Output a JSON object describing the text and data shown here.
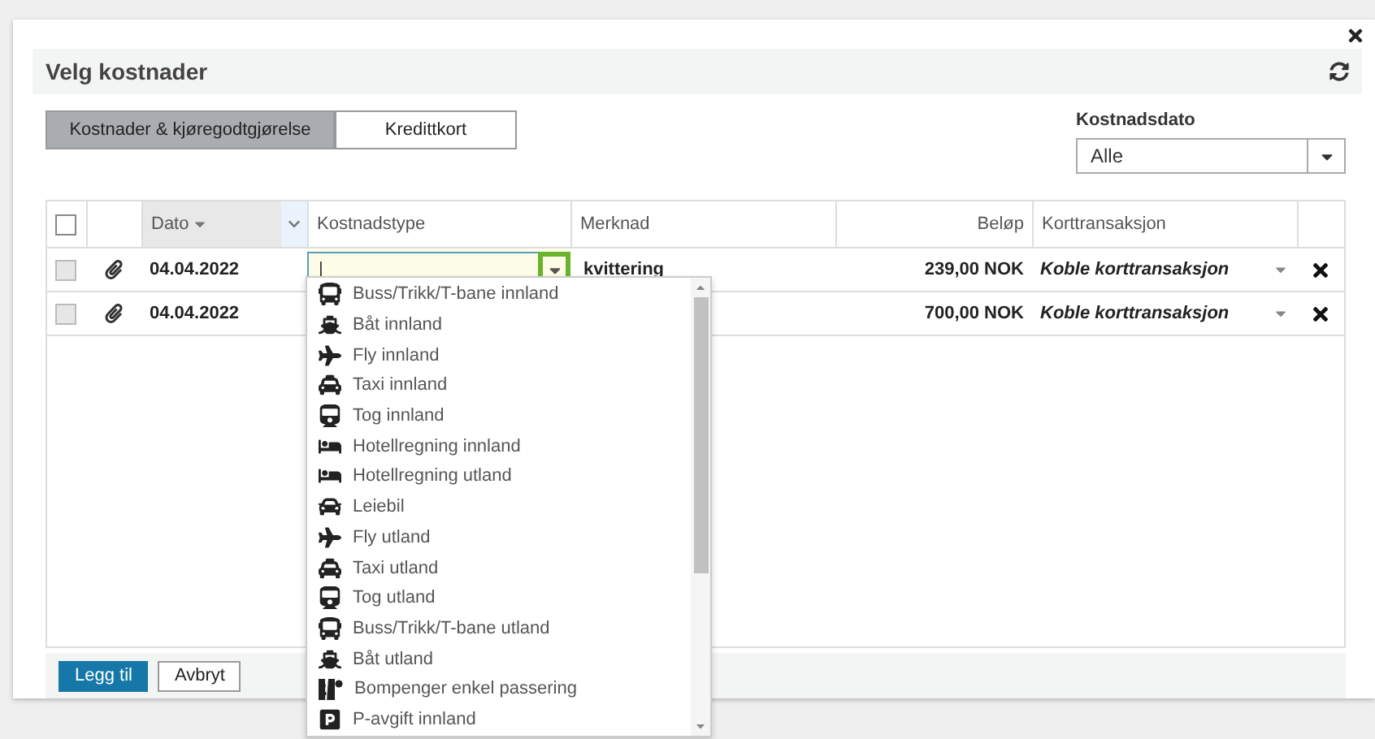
{
  "dialog": {
    "title": "Velg kostnader"
  },
  "tabs": [
    {
      "label": "Kostnader & kjøregodtgjørelse",
      "selected": true
    },
    {
      "label": "Kredittkort",
      "selected": false
    }
  ],
  "date_filter": {
    "label": "Kostnadsdato",
    "value": "Alle"
  },
  "table": {
    "all_selected": false,
    "columns": [
      "Dato",
      "Kostnadstype",
      "Merknad",
      "Beløp",
      "Korttransaksjon"
    ],
    "rows": [
      {
        "checked": false,
        "date": "04.04.2022",
        "cost_type_input": {
          "value": "|"
        },
        "note": "kvittering",
        "amount": "239,00 NOK",
        "card_transaction": "Koble korttransaksjon"
      },
      {
        "checked": false,
        "date": "04.04.2022",
        "amount": "700,00 NOK",
        "card_transaction": "Koble korttransaksjon"
      }
    ]
  },
  "dropdown": {
    "items": [
      {
        "kind": "bus",
        "label": "Buss/Trikk/T-bane innland"
      },
      {
        "kind": "boat",
        "label": "Båt innland"
      },
      {
        "kind": "plane",
        "label": "Fly innland"
      },
      {
        "kind": "taxi",
        "label": "Taxi innland"
      },
      {
        "kind": "train",
        "label": "Tog innland"
      },
      {
        "kind": "hotel",
        "label": "Hotellregning innland"
      },
      {
        "kind": "hotel",
        "label": "Hotellregning utland"
      },
      {
        "kind": "car",
        "label": "Leiebil"
      },
      {
        "kind": "plane",
        "label": "Fly utland"
      },
      {
        "kind": "taxi",
        "label": "Taxi utland"
      },
      {
        "kind": "train",
        "label": "Tog utland"
      },
      {
        "kind": "bus",
        "label": "Buss/Trikk/T-bane utland"
      },
      {
        "kind": "boat",
        "label": "Båt utland"
      },
      {
        "kind": "toll",
        "label": "Bompenger enkel passering"
      },
      {
        "kind": "parking",
        "label": "P-avgift innland"
      }
    ]
  },
  "buttons": [
    {
      "kind": "primary",
      "label": "Legg til"
    },
    {
      "kind": "secondary",
      "label": "Avbryt"
    }
  ]
}
